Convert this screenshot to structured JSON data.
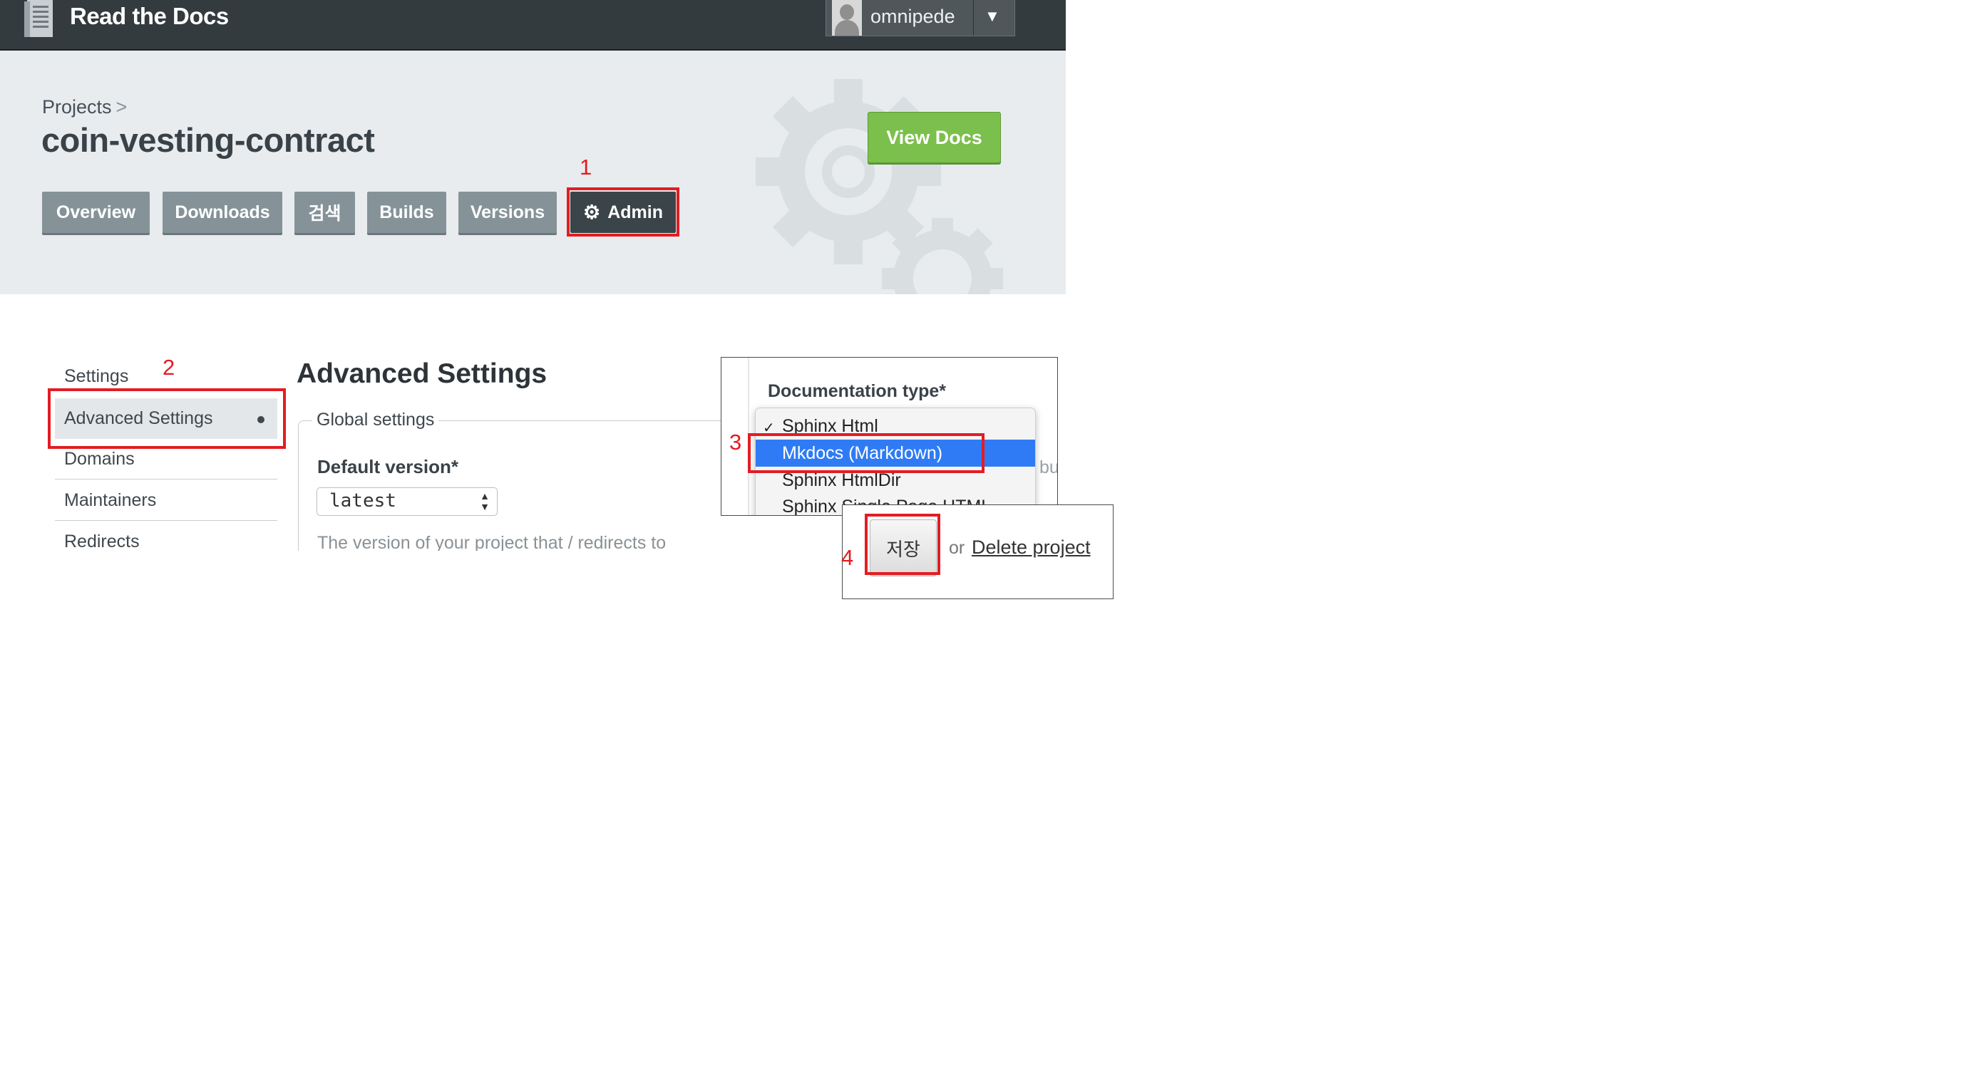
{
  "nav": {
    "brand": "Read the Docs",
    "username": "omnipede",
    "caret": "▼"
  },
  "header": {
    "breadcrumb": "Projects",
    "breadcrumb_sep": ">",
    "project_title": "coin-vesting-contract",
    "view_docs": "View Docs",
    "tabs": [
      {
        "label": "Overview"
      },
      {
        "label": "Downloads"
      },
      {
        "label": "검색"
      },
      {
        "label": "Builds"
      },
      {
        "label": "Versions"
      },
      {
        "label": "Admin",
        "active": true
      }
    ]
  },
  "sidebar": {
    "items": [
      {
        "label": "Settings"
      },
      {
        "label": "Advanced Settings",
        "active": true
      },
      {
        "label": "Domains"
      },
      {
        "label": "Maintainers"
      },
      {
        "label": "Redirects"
      }
    ]
  },
  "main": {
    "heading": "Advanced Settings",
    "fieldset_legend": "Global settings",
    "default_version_label": "Default version*",
    "default_version_value": "latest",
    "default_version_help": "The version of your project that / redirects to"
  },
  "doc_type": {
    "label": "Documentation type*",
    "options": [
      {
        "label": "Sphinx Html",
        "checked": true
      },
      {
        "label": "Mkdocs (Markdown)",
        "highlighted": true
      },
      {
        "label": "Sphinx HtmlDir"
      },
      {
        "label": "Sphinx Single Page HTML"
      }
    ],
    "side_fragment": "bu"
  },
  "save": {
    "button": "저장",
    "or": "or",
    "delete_link": "Delete project"
  },
  "annotations": {
    "step1": "1",
    "step2": "2",
    "step3": "3",
    "step4": "4",
    "color": "#e31c22"
  },
  "colors": {
    "nav_bg": "#343b3f",
    "header_bg": "#e9ecee",
    "tab_bg": "#859399",
    "tab_active_bg": "#3b4448",
    "view_docs_bg": "#7bbf4c",
    "option_highlight": "#2f7bf6"
  }
}
